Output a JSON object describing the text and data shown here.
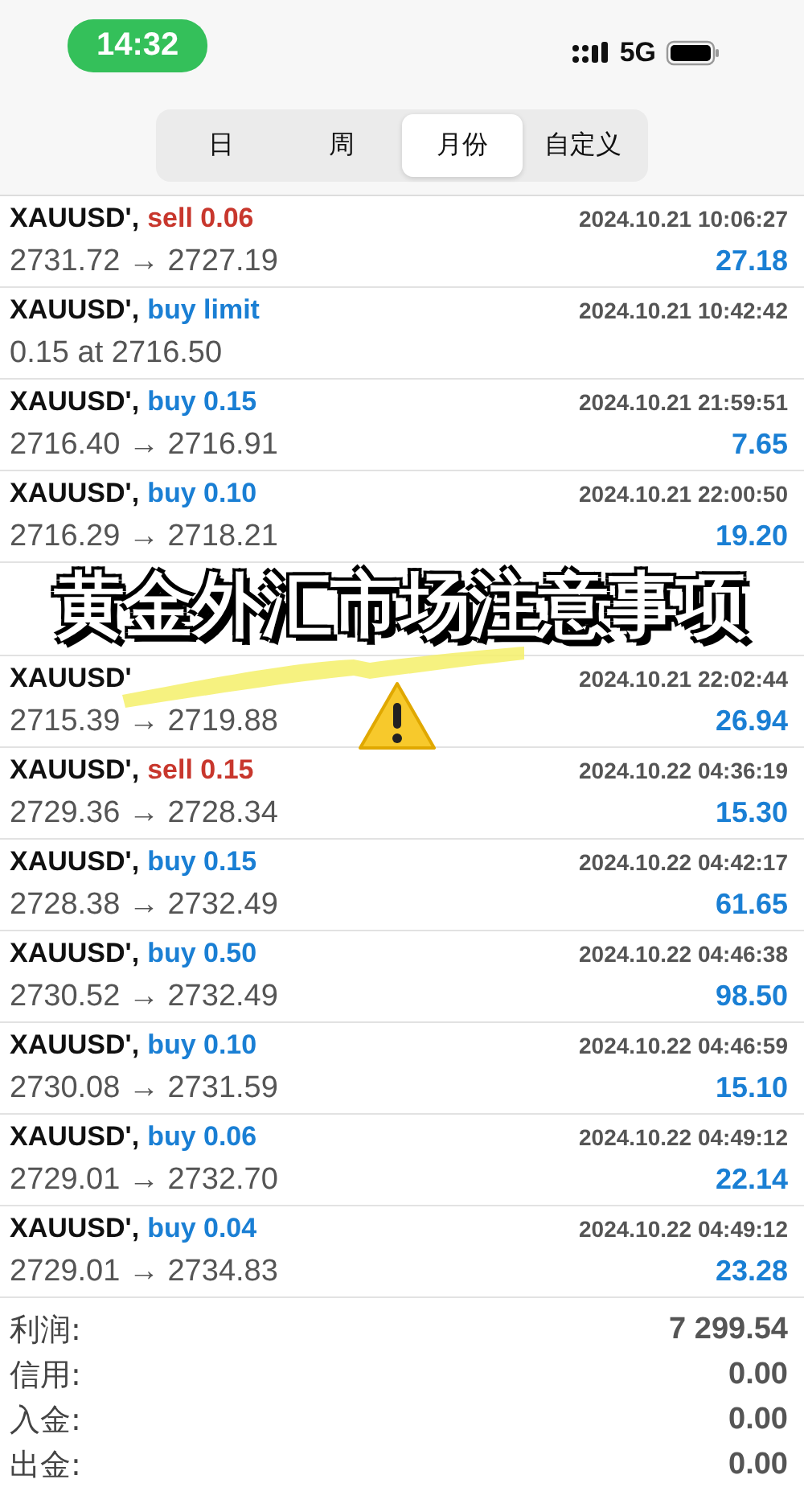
{
  "status_bar": {
    "time": "14:32",
    "network": "5G"
  },
  "tabs": [
    {
      "label": "日",
      "selected": false
    },
    {
      "label": "周",
      "selected": false
    },
    {
      "label": "月份",
      "selected": true
    },
    {
      "label": "自定义",
      "selected": false
    }
  ],
  "deals": [
    {
      "kind": "deal",
      "symbol": "XAUUSD',",
      "color": "#c8372d",
      "order": "sell 0.06",
      "time": "2024.10.21 10:06:27",
      "prices": "2731.72 → 2727.19",
      "profit": "27.18"
    },
    {
      "kind": "deal",
      "symbol": "XAUUSD',",
      "color": "#1a7fd4",
      "order": "buy limit",
      "time": "2024.10.21 10:42:42",
      "prices": "0.15 at 2716.50"
    },
    {
      "kind": "deal",
      "symbol": "XAUUSD',",
      "color": "#1a7fd4",
      "order": "buy 0.15",
      "time": "2024.10.21 21:59:51",
      "prices": "2716.40 → 2716.91",
      "profit": "7.65"
    },
    {
      "kind": "deal",
      "symbol": "XAUUSD',",
      "color": "#1a7fd4",
      "order": "buy 0.10",
      "time": "2024.10.21 22:00:50",
      "prices": "2716.29 → 2718.21",
      "profit": "19.20"
    },
    {
      "kind": "caption",
      "text": "黄金外汇市场注意事项"
    },
    {
      "kind": "deal",
      "symbol": "XAUUSD'",
      "time": "2024.10.21 22:02:44",
      "prices": "2715.39 → 2719.88",
      "profit": "26.94",
      "marked": true
    },
    {
      "kind": "deal",
      "symbol": "XAUUSD',",
      "color": "#c8372d",
      "order": "sell 0.15",
      "time": "2024.10.22 04:36:19",
      "prices": "2729.36 → 2728.34",
      "profit": "15.30"
    },
    {
      "kind": "deal",
      "symbol": "XAUUSD',",
      "color": "#1a7fd4",
      "order": "buy 0.15",
      "time": "2024.10.22 04:42:17",
      "prices": "2728.38 → 2732.49",
      "profit": "61.65"
    },
    {
      "kind": "deal",
      "symbol": "XAUUSD',",
      "color": "#1a7fd4",
      "order": "buy 0.50",
      "time": "2024.10.22 04:46:38",
      "prices": "2730.52 → 2732.49",
      "profit": "98.50"
    },
    {
      "kind": "deal",
      "symbol": "XAUUSD',",
      "color": "#1a7fd4",
      "order": "buy 0.10",
      "time": "2024.10.22 04:46:59",
      "prices": "2730.08 → 2731.59",
      "profit": "15.10"
    },
    {
      "kind": "deal",
      "symbol": "XAUUSD',",
      "color": "#1a7fd4",
      "order": "buy 0.06",
      "time": "2024.10.22 04:49:12",
      "prices": "2729.01 → 2732.70",
      "profit": "22.14"
    },
    {
      "kind": "deal",
      "symbol": "XAUUSD',",
      "color": "#1a7fd4",
      "order": "buy 0.04",
      "time": "2024.10.22 04:49:12",
      "prices": "2729.01 → 2734.83",
      "profit": "23.28"
    }
  ],
  "summary": [
    {
      "label": "利润:",
      "value": "7 299.54"
    },
    {
      "label": "信用:",
      "value": "0.00"
    },
    {
      "label": "入金:",
      "value": "0.00"
    },
    {
      "label": "出金:",
      "value": "0.00"
    }
  ]
}
